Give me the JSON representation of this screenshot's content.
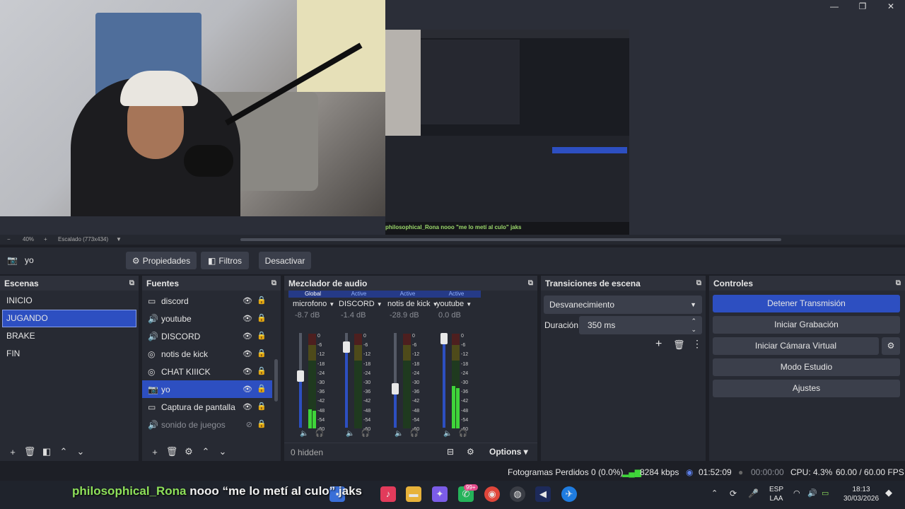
{
  "window_controls": {
    "minimize": "—",
    "maximize": "❐",
    "close": "✕"
  },
  "preview": {
    "zoom": "40%",
    "scale_label": "Escalado (773x434)",
    "nested_chat": "philosophical_Rona  nooo \"me lo metí al culo\" jaks"
  },
  "source_bar": {
    "current_source": "yo",
    "properties": "Propiedades",
    "filters": "Filtros",
    "deactivate": "Desactivar"
  },
  "scenes": {
    "title": "Escenas",
    "items": [
      {
        "label": "INICIO"
      },
      {
        "label": "JUGANDO",
        "selected": true
      },
      {
        "label": "BRAKE"
      },
      {
        "label": "FIN"
      }
    ]
  },
  "sources": {
    "title": "Fuentes",
    "items": [
      {
        "label": "discord",
        "icon": "window-icon"
      },
      {
        "label": "youtube",
        "icon": "audio-icon"
      },
      {
        "label": "DISCORD",
        "icon": "audio-icon"
      },
      {
        "label": "notis de kick",
        "icon": "browser-icon"
      },
      {
        "label": "CHAT KIIICK",
        "icon": "browser-icon"
      },
      {
        "label": "yo",
        "icon": "camera-icon",
        "selected": true
      },
      {
        "label": "Captura de pantalla",
        "icon": "monitor-icon"
      },
      {
        "label": "sonido de juegos",
        "icon": "audio-icon",
        "hidden": true
      }
    ]
  },
  "mixer": {
    "title": "Mezclador de audio",
    "channels": [
      {
        "state": "Global",
        "name": "microfono",
        "db": "-8.7 dB",
        "fader": 0.55,
        "level": 0.2
      },
      {
        "state": "Active",
        "name": "DISCORD",
        "db": "-1.4 dB",
        "fader": 0.9,
        "level": 0.0
      },
      {
        "state": "Active",
        "name": "notis de kick",
        "db": "-28.9 dB",
        "fader": 0.4,
        "level": 0.0
      },
      {
        "state": "Active",
        "name": "youtube",
        "db": "0.0 dB",
        "fader": 1.0,
        "level": 0.45
      }
    ],
    "scale": [
      "0",
      "-6",
      "-12",
      "-18",
      "-24",
      "-30",
      "-36",
      "-42",
      "-48",
      "-54",
      "-60"
    ],
    "hidden_count": "0 hidden",
    "options": "Options"
  },
  "transitions": {
    "title": "Transiciones de escena",
    "selected": "Desvanecimiento",
    "duration_label": "Duración",
    "duration_value": "350 ms"
  },
  "controls": {
    "title": "Controles",
    "stop_stream": "Detener Transmisión",
    "start_recording": "Iniciar Grabación",
    "start_virtual_cam": "Iniciar Cámara Virtual",
    "studio_mode": "Modo Estudio",
    "settings": "Ajustes"
  },
  "status": {
    "dropped_frames": "Fotogramas Perdidos 0 (0.0%)",
    "bitrate": "8284 kbps",
    "stream_time": "01:52:09",
    "record_time": "00:00:00",
    "cpu": "CPU: 4.3%",
    "fps": "60.00 / 60.00 FPS"
  },
  "chat_overlay": {
    "user": "philosophical_Rona",
    "message": "nooo “me lo metí al culo” jaks"
  },
  "taskbar": {
    "notification_badge": "99+",
    "lang_top": "ESP",
    "lang_bottom": "LAA",
    "time": "18:13",
    "date": "30/03/2026"
  },
  "colors": {
    "accent": "#2d4fc1",
    "meter_green": "#3fd43a",
    "chat_user": "#8ee05a"
  }
}
